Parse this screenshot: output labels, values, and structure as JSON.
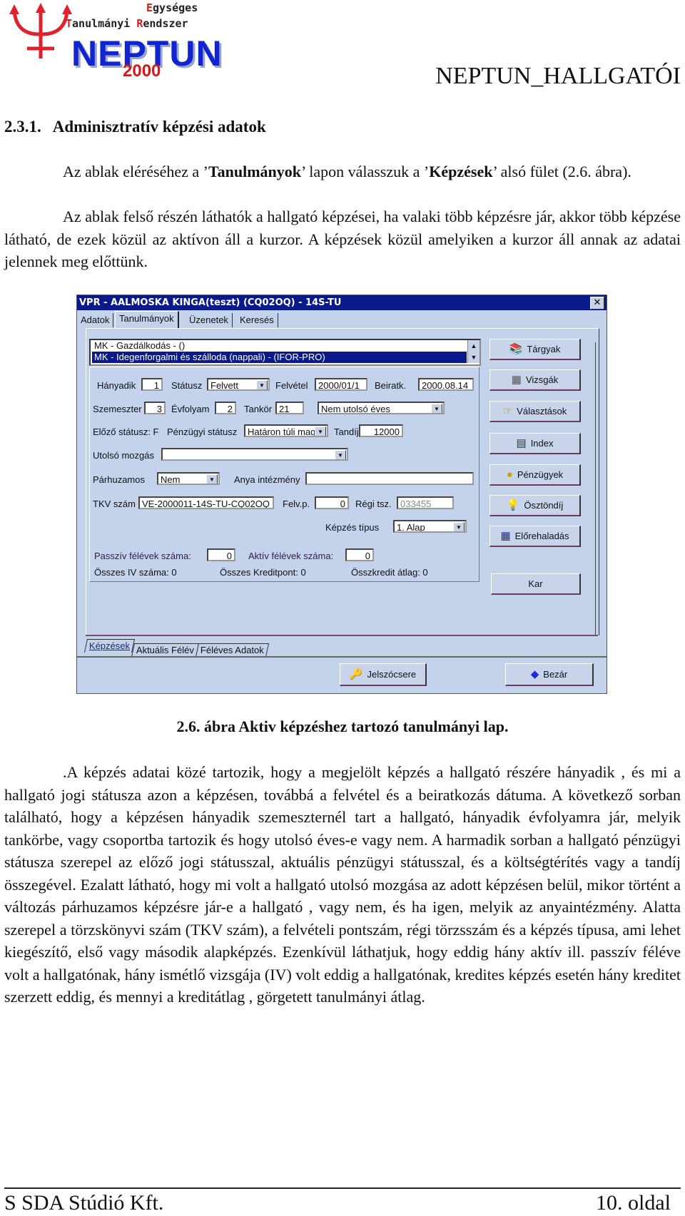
{
  "logo": {
    "line1_first": "E",
    "line1_rest": "gységes",
    "line2_a_first": "T",
    "line2_a_rest": "anulmányi ",
    "line2_b_first": "R",
    "line2_b_rest": "endszer",
    "brand": "NEPTUN",
    "year": "2000"
  },
  "header": {
    "doc_title": "NEPTUN_HALLGATÓI"
  },
  "section": {
    "title": "2.3.1.   Adminisztratív képzési adatok"
  },
  "intro": {
    "p1_a": "Az ablak eléréséhez a ’",
    "p1_b": "Tanulmányok",
    "p1_c": "’ lapon válasszuk a ’",
    "p1_d": "Képzések",
    "p1_e": "’ alsó fület (2.6. ábra).",
    "p2": "Az ablak felső részén láthatók a hallgató képzései, ha valaki több képzésre jár, akkor több képzése látható, de ezek közül az aktívon áll a kurzor. A képzések közül amelyiken a kurzor áll annak az adatai jelennek meg előttünk."
  },
  "window": {
    "title": "VPR - AALMOSKA KINGA(teszt) (CQ02OQ) - 14S-TU",
    "close": "✕",
    "tabs": [
      "Adatok",
      "Tanulmányok",
      "Üzenetek",
      "Keresés"
    ],
    "active_tab": "Tanulmányok",
    "list": {
      "items": [
        "MK - Gazdálkodás - ()",
        "MK - Idegenforgalmi és szálloda (nappali) - (IFOR-PRO)"
      ],
      "selected_index": 1
    },
    "form": {
      "hanyadik_label": "Hányadik",
      "hanyadik": "1",
      "statusz_label": "Státusz",
      "statusz": "Felvett",
      "felvetel_label": "Felvétel",
      "felvetel": "2000/01/1",
      "beiratk_label": "Beiratk.",
      "beiratk": "2000.08.14",
      "szemeszter_label": "Szemeszter",
      "szemeszter": "3",
      "evfolyam_label": "Évfolyam",
      "evfolyam": "2",
      "tankor_label": "Tankör",
      "tankor": "21",
      "utolso_eves": "Nem utolsó éves",
      "elozo_statusz": "Előző státusz: F",
      "penzugyi_label": "Pénzügyi státusz",
      "penzugyi": "Határon túli mag",
      "tandij_label": "Tandíj",
      "tandij": "12000",
      "utolso_mozgas_label": "Utolsó mozgás",
      "utolso_mozgas": "",
      "parhuzamos_label": "Párhuzamos",
      "parhuzamos": "Nem",
      "anya_label": "Anya intézmény",
      "anya": "",
      "tkv_label": "TKV szám",
      "tkv": "VE-2000011-14S-TU-CQ02OQ",
      "felvp_label": "Felv.p.",
      "felvp": "0",
      "regitsz_label": "Régi tsz.",
      "regitsz": "033455",
      "kepzes_tipus_label": "Képzés típus",
      "kepzes_tipus": "1. Alap",
      "passziv_label": "Passzív félévek száma:",
      "passziv": "0",
      "aktiv_label": "Aktív félévek száma:",
      "aktiv": "0",
      "osszes_iv": "Összes IV száma: 0",
      "osszes_kredit": "Összes Kreditpont: 0",
      "osszkredit_atlag": "Összkredit átlag: 0"
    },
    "side_buttons": [
      {
        "label": "Tárgyak",
        "icon": "books-icon",
        "glyph": "📚"
      },
      {
        "label": "Vizsgák",
        "icon": "calculator-icon",
        "glyph": "▦"
      },
      {
        "label": "Választások",
        "icon": "pointing-hand-icon",
        "glyph": "☞"
      },
      {
        "label": "Index",
        "icon": "documents-icon",
        "glyph": "▤"
      },
      {
        "label": "Pénzügyek",
        "icon": "coin-icon",
        "glyph": "●"
      },
      {
        "label": "Ösztöndíj",
        "icon": "lightbulb-icon",
        "glyph": "💡"
      },
      {
        "label": "Előrehaladás",
        "icon": "calendar-icon",
        "glyph": "▦"
      },
      {
        "label": "Kar",
        "icon": "",
        "glyph": ""
      }
    ],
    "bottom_tabs": [
      "Képzések",
      "Aktuális Félév",
      "Féléves Adatok"
    ],
    "bottom_buttons": {
      "jelszocsere": "Jelszócsere",
      "bezar": "Bezár"
    },
    "dropdown_arrow": "▼",
    "scroll_up": "▲",
    "scroll_down": "▼"
  },
  "caption": "2.6. ábra Aktiv képzéshez tartozó tanulmányi lap.",
  "body_text": ".A képzés adatai közé tartozik, hogy a megjelölt képzés a hallgató részére hányadik , és mi a hallgató jogi státusza azon a képzésen, továbbá a felvétel és a beiratkozás dátuma. A következő sorban található, hogy a képzésen hányadik szemeszternél tart a hallgató, hányadik évfolyamra jár, melyik tankörbe, vagy csoportba tartozik és hogy utolsó éves-e vagy nem. A harmadik sorban a hallgató pénzügyi státusza szerepel az előző jogi státusszal, aktuális pénzügyi státusszal, és a költségtérítés vagy a tandíj  összegével. Ezalatt látható, hogy mi volt a hallgató utolsó mozgása az adott képzésen belül, mikor történt a változás párhuzamos képzésre jár-e a hallgató , vagy nem, és ha igen, melyik az anyaintézmény. Alatta szerepel a törzskönyvi szám (TKV szám), a felvételi pontszám, régi törzsszám és a képzés típusa, ami lehet kiegészítő, első vagy második alapképzés. Ezenkívül láthatjuk, hogy eddig hány aktív ill. passzív féléve volt a hallgatónak, hány ismétlő vizsgája (IV) volt eddig a hallgatónak, kredites képzés esetén hány kreditet szerzett eddig, és mennyi a kreditátlag , görgetett tanulmányi átlag.",
  "footer": {
    "left": "S SDA Stúdió Kft.",
    "right": "10. oldal"
  }
}
